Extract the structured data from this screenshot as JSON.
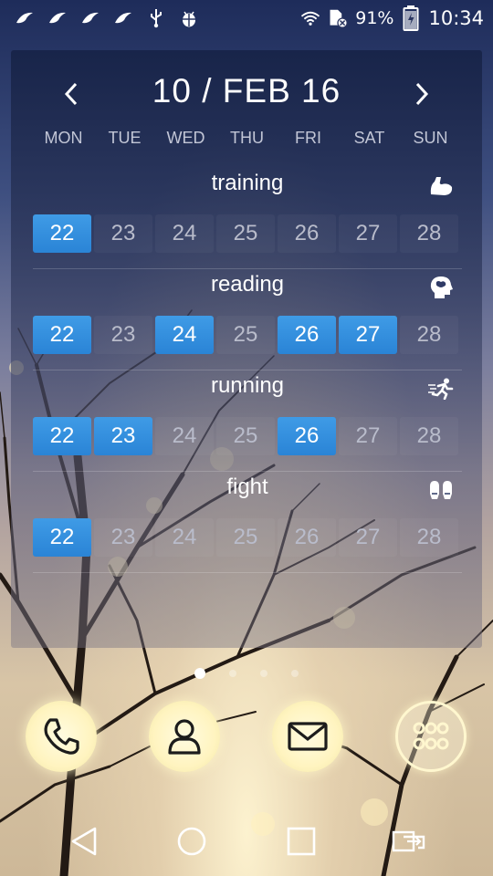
{
  "status_bar": {
    "left_icons": [
      "bird-notification-icon",
      "bird-notification-icon",
      "bird-notification-icon",
      "bird-notification-icon",
      "usb-icon",
      "android-debug-icon"
    ],
    "battery_percent": "91%",
    "time": "10:34"
  },
  "widget": {
    "title": "10 / FEB 16",
    "weekdays": [
      "MON",
      "TUE",
      "WED",
      "THU",
      "FRI",
      "SAT",
      "SUN"
    ],
    "habits": [
      {
        "name": "training",
        "icon": "muscle-arm-icon",
        "days": [
          "22",
          "23",
          "24",
          "25",
          "26",
          "27",
          "28"
        ],
        "done": [
          true,
          false,
          false,
          false,
          false,
          false,
          false
        ]
      },
      {
        "name": "reading",
        "icon": "brain-head-icon",
        "days": [
          "22",
          "23",
          "24",
          "25",
          "26",
          "27",
          "28"
        ],
        "done": [
          true,
          false,
          true,
          false,
          true,
          true,
          false
        ]
      },
      {
        "name": "running",
        "icon": "runner-icon",
        "days": [
          "22",
          "23",
          "24",
          "25",
          "26",
          "27",
          "28"
        ],
        "done": [
          true,
          true,
          false,
          false,
          true,
          false,
          false
        ]
      },
      {
        "name": "fight",
        "icon": "boxing-gloves-icon",
        "days": [
          "22",
          "23",
          "24",
          "25",
          "26",
          "27",
          "28"
        ],
        "done": [
          true,
          false,
          false,
          false,
          false,
          false,
          false
        ]
      }
    ]
  },
  "page_indicator": {
    "count": 4,
    "active": 0
  },
  "dock": [
    "phone-icon",
    "contacts-icon",
    "email-icon",
    "app-drawer-icon"
  ],
  "nav_bar": [
    "back-icon",
    "home-icon",
    "recents-icon",
    "screen-mirror-icon"
  ],
  "colors": {
    "accent": "#2f8fe0",
    "glow": "#fff6c8"
  }
}
